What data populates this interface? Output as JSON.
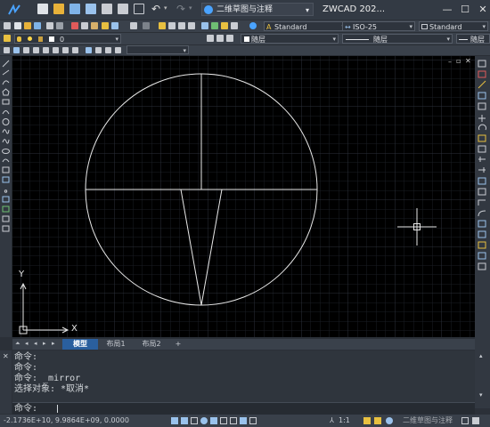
{
  "titlebar": {
    "workspace": "二维草图与注释",
    "app_title": "ZWCAD 202..."
  },
  "toolbar2": {
    "text_style": "Standard",
    "dim_style": "ISO-25",
    "table_style": "Standard"
  },
  "toolbar3": {
    "layer_value": "0",
    "color_value": "随层",
    "linetype_value": "随层",
    "lineweight_value": "随层"
  },
  "tabs": [
    "模型",
    "布局1",
    "布局2",
    "+"
  ],
  "ucs": {
    "x_label": "X",
    "y_label": "Y"
  },
  "command": {
    "history": [
      "命令:",
      "命令:",
      "命令: _mirror",
      "选择对象: *取消*"
    ],
    "prompt": "命令:"
  },
  "status": {
    "coords": "-2.1736E+10, 9.9864E+09, 0.0000",
    "scale": "1:1",
    "workspace": "二维草图与注释"
  }
}
